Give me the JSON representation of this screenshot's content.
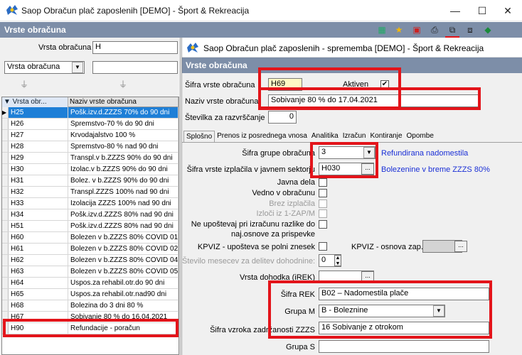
{
  "window": {
    "title": "Saop Obračun plač zaposlenih [DEMO] - Šport & Rekreacija",
    "min": "—",
    "max": "☐",
    "close": "✕"
  },
  "panel": {
    "title": "Vrste obračuna"
  },
  "filter": {
    "label": "Vrsta obračuna",
    "value": "H",
    "combo_value": "Vrsta obračuna",
    "combo_arrow": "▼"
  },
  "grid": {
    "headers": [
      "▼ Vrsta obr...",
      "Naziv vrste obračuna"
    ],
    "rows": [
      {
        "code": "H25",
        "name": "Pošk.izv.d.ZZZS 70% do 90 dni"
      },
      {
        "code": "H26",
        "name": "Spremstvo-70 % do 90 dni"
      },
      {
        "code": "H27",
        "name": "Krvodajalstvo 100 %"
      },
      {
        "code": "H28",
        "name": "Spremstvo-80 % nad 90 dni"
      },
      {
        "code": "H29",
        "name": "Transpl.v b.ZZZS 90% do 90 dni"
      },
      {
        "code": "H30",
        "name": "Izolac.v b.ZZZS 90% do 90 dni"
      },
      {
        "code": "H31",
        "name": "Bolez. v b.ZZZS 90% do 90 dni"
      },
      {
        "code": "H32",
        "name": "Transpl.ZZZS 100% nad 90 dni"
      },
      {
        "code": "H33",
        "name": "Izolacija ZZZS 100% nad 90 dni"
      },
      {
        "code": "H34",
        "name": "Pošk.izv.d.ZZZS 80% nad 90 dni"
      },
      {
        "code": "H51",
        "name": "Pošk.izv.d.ZZZS 80% nad 90 dni"
      },
      {
        "code": "H60",
        "name": "Bolezen v b.ZZZS 80% COVID 01"
      },
      {
        "code": "H61",
        "name": "Bolezen v b.ZZZS 80% COVID 02"
      },
      {
        "code": "H62",
        "name": "Bolezen v b.ZZZS 80% COVID 04"
      },
      {
        "code": "H63",
        "name": "Bolezen v b.ZZZS 80% COVID 05"
      },
      {
        "code": "H64",
        "name": "Uspos.za rehabil.otr.do 90 dni"
      },
      {
        "code": "H65",
        "name": "Uspos.za rehabil.otr.nad90 dni"
      },
      {
        "code": "H68",
        "name": "Bolezina do 3 dni 80 %"
      },
      {
        "code": "H67",
        "name": "Sobivanje 80 % do 16.04.2021"
      },
      {
        "code": "H90",
        "name": "Refundacije - poračun"
      }
    ]
  },
  "dialog": {
    "title": "Saop Obračun plač zaposlenih - sprememba [DEMO] - Šport & Rekreacija",
    "header": "Vrste obračuna",
    "sifra_label": "Šifra vrste obračuna",
    "sifra_value": "H69",
    "aktiven_label": "Aktiven",
    "aktiven_check": "✔",
    "naziv_label": "Naziv vrste obračuna",
    "naziv_value": "Sobivanje 80 % do 17.04.2021",
    "stevilka_label": "Številka za razvrščanje",
    "stevilka_value": "0",
    "tabs": [
      "Splošno",
      "Prenos iz posrednega vnosa",
      "Analitika",
      "Izračun",
      "Kontiranje",
      "Opombe"
    ],
    "grupa_label": "Šifra grupe obračuna",
    "grupa_value": "3",
    "grupa_desc": "Refundirana nadomestila",
    "izplacila_label": "Šifra vrste izplačila v javnem sektorju",
    "izplacila_value": "H030",
    "izplacila_desc": "Bolezenine v breme ZZZS 80%",
    "javna_dela": "Javna dela",
    "vedno": "Vedno v obračunu",
    "brez": "Brez izplačila",
    "izloci": "Izloči iz 1-ZAP/M",
    "ne_upostevaj_1": "Ne upoštevaj pri izračunu razlike do",
    "ne_upostevaj_2": "naj.osnove za prispevke",
    "kpviz1": "KPVIZ - upošteva se polni znesek",
    "kpviz2": "KPVIZ - osnova zap.",
    "stevilo_label": "Število mesecev za delitev dohodnine:",
    "stevilo_value": "0",
    "dohodka_label": "Vrsta dohodka (iREK)",
    "rek_label": "Šifra REK",
    "rek_value": "B02 – Nadomestila plače",
    "grupam_label": "Grupa M",
    "grupam_value": "B - Boleznine",
    "vzroka_label": "Šifra vzroka zadržanosti ZZZS",
    "vzroka_value": "16 Sobivanje z otrokom",
    "grupas_label": "Grupa S",
    "dots": "...",
    "arrow": "▼"
  }
}
